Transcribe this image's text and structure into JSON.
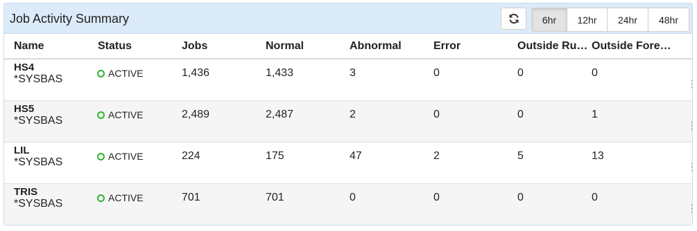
{
  "panel": {
    "title": "Job Activity Summary",
    "refresh_icon": "refresh-icon",
    "ranges": [
      {
        "label": "6hr",
        "active": true
      },
      {
        "label": "12hr",
        "active": false
      },
      {
        "label": "24hr",
        "active": false
      },
      {
        "label": "48hr",
        "active": false
      }
    ]
  },
  "table": {
    "columns": [
      "Name",
      "Status",
      "Jobs",
      "Normal",
      "Abnormal",
      "Error",
      "Outside Run…",
      "Outside Fore…"
    ],
    "rows": [
      {
        "name": "HS4",
        "sub": "*SYSBAS",
        "status": "ACTIVE",
        "jobs": "1,436",
        "normal": "1,433",
        "abnormal": "3",
        "error": "0",
        "outside_run": "0",
        "outside_fore": "0"
      },
      {
        "name": "HS5",
        "sub": "*SYSBAS",
        "status": "ACTIVE",
        "jobs": "2,489",
        "normal": "2,487",
        "abnormal": "2",
        "error": "0",
        "outside_run": "0",
        "outside_fore": "1"
      },
      {
        "name": "LIL",
        "sub": "*SYSBAS",
        "status": "ACTIVE",
        "jobs": "224",
        "normal": "175",
        "abnormal": "47",
        "error": "2",
        "outside_run": "5",
        "outside_fore": "13"
      },
      {
        "name": "TRIS",
        "sub": "*SYSBAS",
        "status": "ACTIVE",
        "jobs": "701",
        "normal": "701",
        "abnormal": "0",
        "error": "0",
        "outside_run": "0",
        "outside_fore": "0"
      }
    ]
  },
  "colors": {
    "header_bg": "#dcebf9",
    "status_active": "#2bb52b",
    "row_alt": "#f5f5f5"
  }
}
